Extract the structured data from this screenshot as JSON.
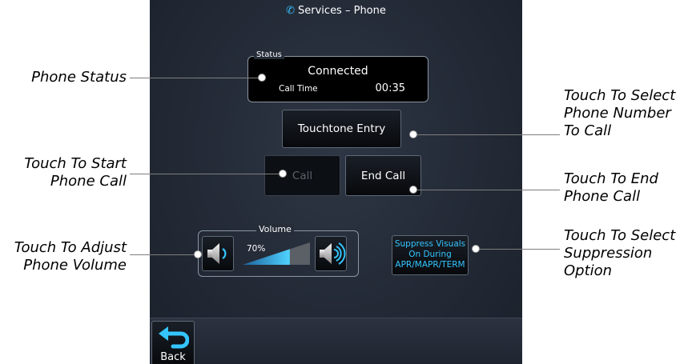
{
  "screen": {
    "title": "Services – Phone",
    "title_icon": "phone-icon"
  },
  "status": {
    "legend": "Status",
    "value": "Connected",
    "call_time_label": "Call Time",
    "call_time_value": "00:35"
  },
  "buttons": {
    "touchtone": "Touchtone Entry",
    "call": "Call",
    "end_call": "End Call"
  },
  "volume": {
    "legend": "Volume",
    "level_percent": 70,
    "level_label": "70%",
    "down_icon": "speaker-low-icon",
    "up_icon": "speaker-high-icon"
  },
  "suppress": {
    "line1": "Suppress Visuals",
    "line2": "On During",
    "line3": "APR/MAPR/TERM"
  },
  "back": {
    "label": "Back",
    "icon": "back-arrow-icon"
  },
  "colors": {
    "accent": "#34c5ff",
    "screen_bg": "#262d39"
  },
  "callouts": {
    "phone_status": "Phone Status",
    "start_call_1": "Touch To Start",
    "start_call_2": "Phone Call",
    "adjust_volume_1": "Touch To Adjust",
    "adjust_volume_2": "Phone Volume",
    "select_number_1": "Touch To Select",
    "select_number_2": "Phone Number",
    "select_number_3": "To Call",
    "end_call_1": "Touch To End",
    "end_call_2": "Phone Call",
    "suppression_1": "Touch To Select",
    "suppression_2": "Suppression",
    "suppression_3": "Option"
  }
}
